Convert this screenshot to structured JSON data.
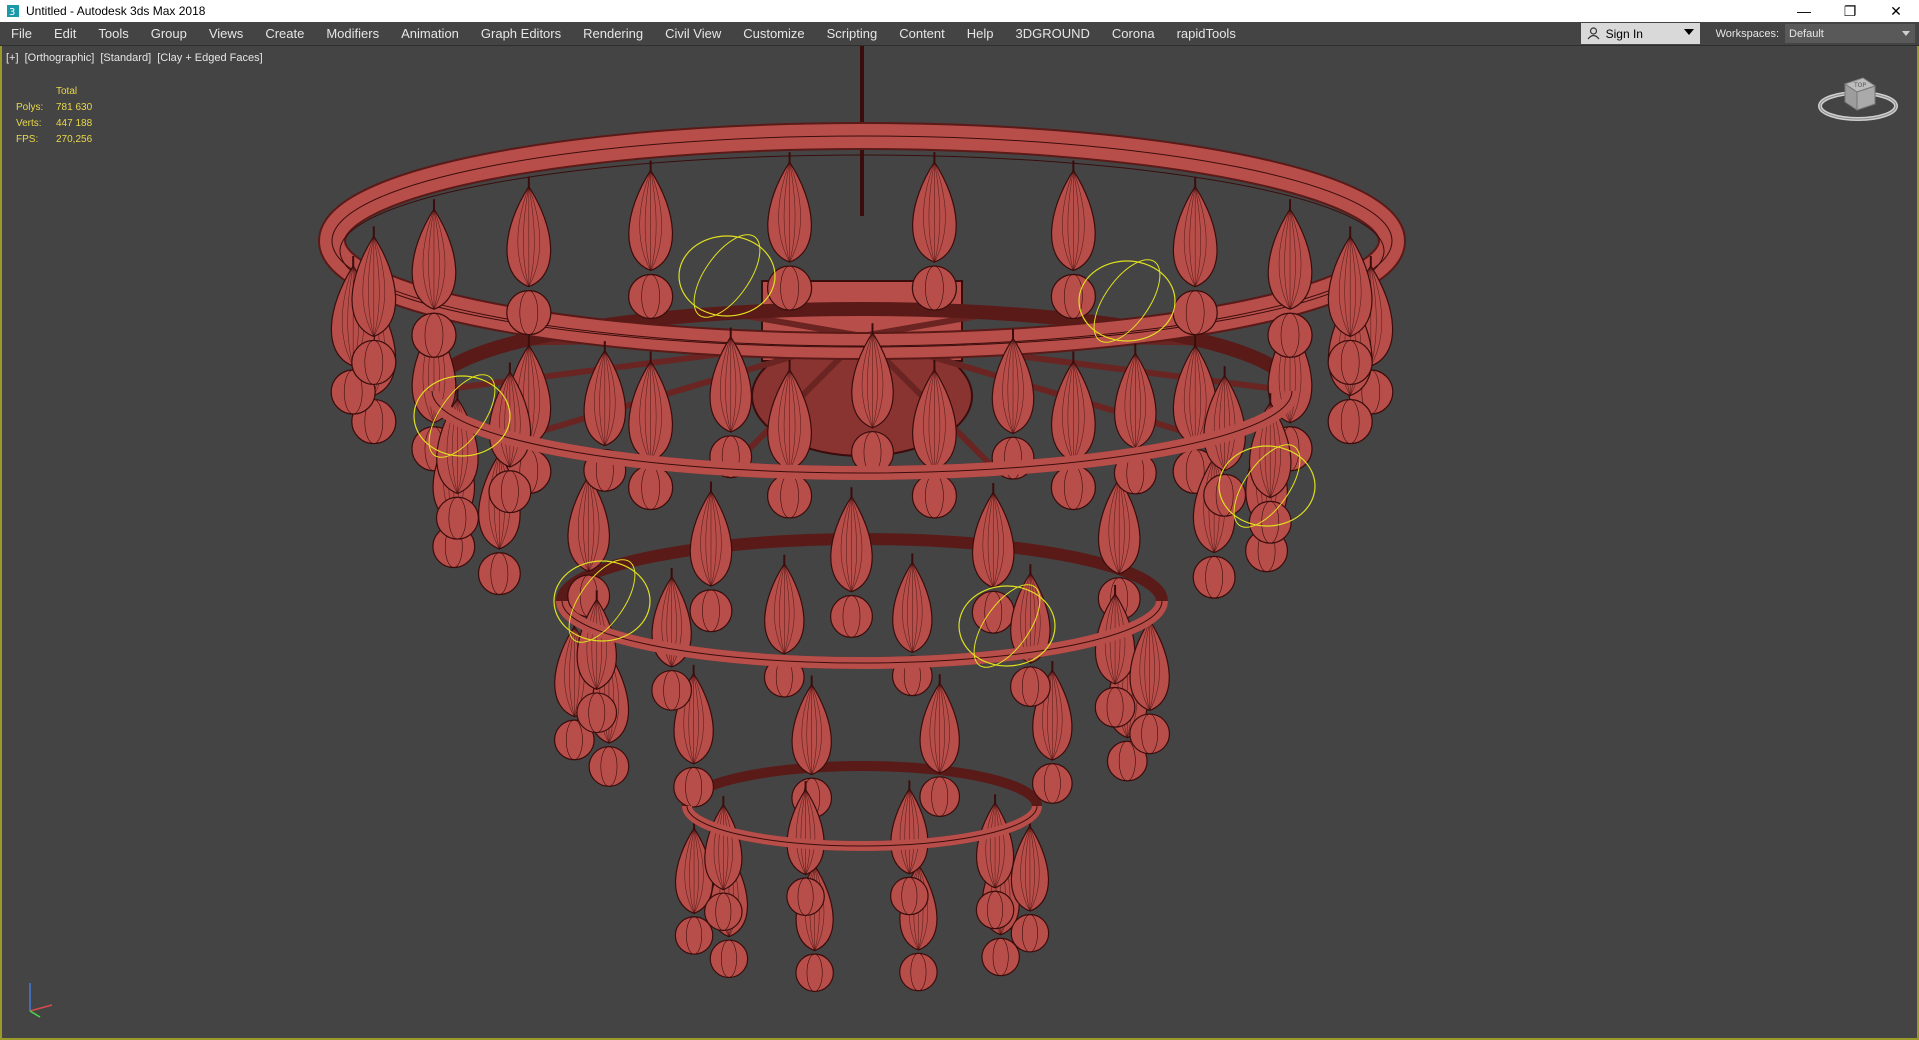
{
  "window": {
    "title": "Untitled - Autodesk 3ds Max 2018",
    "icon": "3dsmax-app-icon",
    "controls": [
      "minimize-icon",
      "restore-icon",
      "close-icon"
    ]
  },
  "menubar": {
    "items": [
      "File",
      "Edit",
      "Tools",
      "Group",
      "Views",
      "Create",
      "Modifiers",
      "Animation",
      "Graph Editors",
      "Rendering",
      "Civil View",
      "Customize",
      "Scripting",
      "Content",
      "Help",
      "3DGROUND",
      "Corona",
      "rapidTools"
    ],
    "sign_in": "Sign In",
    "workspaces_label": "Workspaces:",
    "workspace_value": "Default"
  },
  "viewport": {
    "labels": [
      "[+]",
      "[Orthographic]",
      "[Standard]",
      "[Clay + Edged Faces]"
    ],
    "stats": {
      "header": "Total",
      "polys_label": "Polys:",
      "polys": "781 630",
      "verts_label": "Verts:",
      "verts": "447 188",
      "fps_label": "FPS:",
      "fps": "270,256"
    },
    "viewcube_label": "TOP"
  },
  "colors": {
    "viewport_bg": "#444444",
    "model_fill": "#b84e4a",
    "model_wire": "#3a0d0c",
    "selection_yellow": "#e0e020",
    "stats_text": "#e8d84a"
  }
}
